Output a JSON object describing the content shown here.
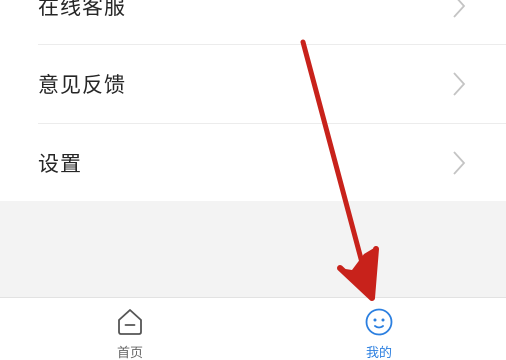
{
  "menu": {
    "items": [
      {
        "label": "在线客服"
      },
      {
        "label": "意见反馈"
      },
      {
        "label": "设置"
      }
    ]
  },
  "tabbar": {
    "tabs": [
      {
        "label": "首页",
        "icon": "home-icon",
        "active": false
      },
      {
        "label": "我的",
        "icon": "smiley-face-icon",
        "active": true
      }
    ]
  },
  "colors": {
    "accent": "#2b7fe0",
    "annotation_arrow": "#c8221b",
    "background_gray": "#f3f3f3"
  }
}
